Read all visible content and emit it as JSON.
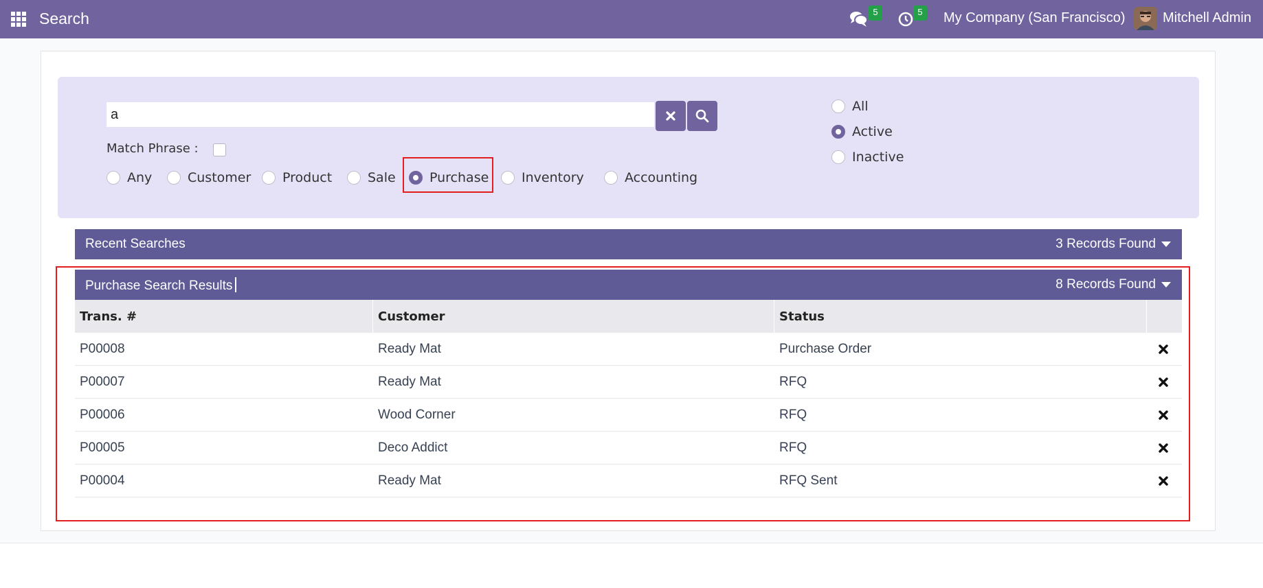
{
  "navbar": {
    "app_title": "Search",
    "messages_count": "5",
    "activities_count": "5",
    "company": "My Company (San Francisco)",
    "user": "Mitchell Admin",
    "color": "#71639e"
  },
  "search": {
    "query": "a",
    "match_phrase_label": "Match Phrase :",
    "match_phrase_checked": false,
    "types": [
      {
        "label": "Any",
        "checked": false
      },
      {
        "label": "Customer",
        "checked": false
      },
      {
        "label": "Product",
        "checked": false
      },
      {
        "label": "Sale",
        "checked": false
      },
      {
        "label": "Purchase",
        "checked": true
      },
      {
        "label": "Inventory",
        "checked": false
      },
      {
        "label": "Accounting",
        "checked": false
      }
    ],
    "status_filters": [
      {
        "label": "All",
        "checked": false
      },
      {
        "label": "Active",
        "checked": true
      },
      {
        "label": "Inactive",
        "checked": false
      }
    ]
  },
  "recent": {
    "title": "Recent Searches",
    "count_label": "3 Records Found"
  },
  "results": {
    "title": "Purchase Search Results",
    "count_label": "8 Records Found",
    "columns": [
      "Trans. #",
      "Customer",
      "Status"
    ],
    "rows": [
      {
        "trans": "P00008",
        "customer": "Ready Mat",
        "status": "Purchase Order"
      },
      {
        "trans": "P00007",
        "customer": "Ready Mat",
        "status": "RFQ"
      },
      {
        "trans": "P00006",
        "customer": "Wood Corner",
        "status": "RFQ"
      },
      {
        "trans": "P00005",
        "customer": "Deco Addict",
        "status": "RFQ"
      },
      {
        "trans": "P00004",
        "customer": "Ready Mat",
        "status": "RFQ Sent"
      }
    ]
  },
  "colors": {
    "accent": "#71639e",
    "bar": "#5f5b97",
    "panel": "#e5e2f7",
    "highlight": "#e11d1d",
    "badge": "#24a148"
  },
  "icons": {
    "apps": "grid-icon",
    "messages": "chat-icon",
    "activities": "clock-icon",
    "clear": "times-icon",
    "search": "search-icon",
    "delete": "times-icon"
  }
}
